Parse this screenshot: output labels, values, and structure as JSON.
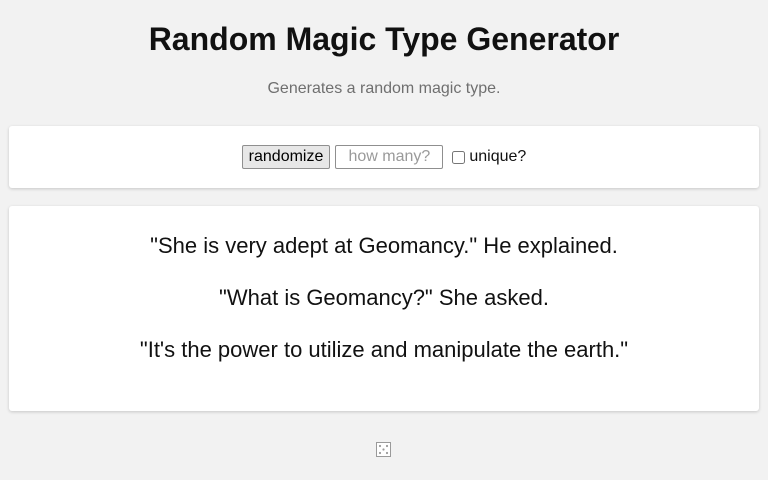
{
  "header": {
    "title": "Random Magic Type Generator",
    "subtitle": "Generates a random magic type."
  },
  "controls": {
    "randomize_label": "randomize",
    "count_placeholder": "how many?",
    "count_value": "",
    "unique_label": "unique?",
    "unique_checked": false
  },
  "output": {
    "lines": [
      "\"She is very adept at Geomancy.\" He explained.",
      "\"What is Geomancy?\" She asked.",
      "\"It's the power to utilize and manipulate the earth.\""
    ]
  },
  "footer": {
    "icon": "dice-icon"
  }
}
